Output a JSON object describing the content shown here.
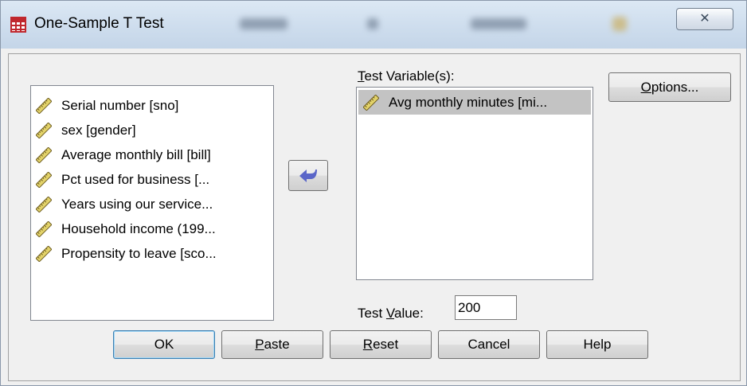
{
  "window": {
    "title": "One-Sample T Test",
    "close_glyph": "✕"
  },
  "source_variables": [
    {
      "label": "Serial number [sno]",
      "icon": "ruler-scale-icon"
    },
    {
      "label": "sex [gender]",
      "icon": "ruler-scale-icon"
    },
    {
      "label": "Average monthly bill [bill]",
      "icon": "ruler-scale-icon"
    },
    {
      "label": "Pct used for business [...",
      "icon": "ruler-scale-icon"
    },
    {
      "label": "Years using our service...",
      "icon": "ruler-scale-icon"
    },
    {
      "label": "Household income (199...",
      "icon": "ruler-scale-icon"
    },
    {
      "label": "Propensity to leave [sco...",
      "icon": "ruler-scale-icon"
    }
  ],
  "test_variables": {
    "label": "Test Variable(s):",
    "mnemonic": "T",
    "items": [
      {
        "label": "Avg monthly minutes [mi...",
        "icon": "ruler-scale-icon",
        "selected": true
      }
    ]
  },
  "move_button": {
    "icon": "arrow-left-icon"
  },
  "options_button": {
    "label": "Options...",
    "mnemonic": "O"
  },
  "test_value": {
    "label": "Test Value:",
    "mnemonic": "V",
    "value": "200"
  },
  "buttons": {
    "ok": "OK",
    "paste": {
      "label": "Paste",
      "mnemonic": "P"
    },
    "reset": {
      "label": "Reset",
      "mnemonic": "R"
    },
    "cancel": "Cancel",
    "help": "Help"
  },
  "colors": {
    "selection": "#c3c3c3",
    "arrow": "#5a66c8",
    "title_icon": "#c0272d"
  }
}
